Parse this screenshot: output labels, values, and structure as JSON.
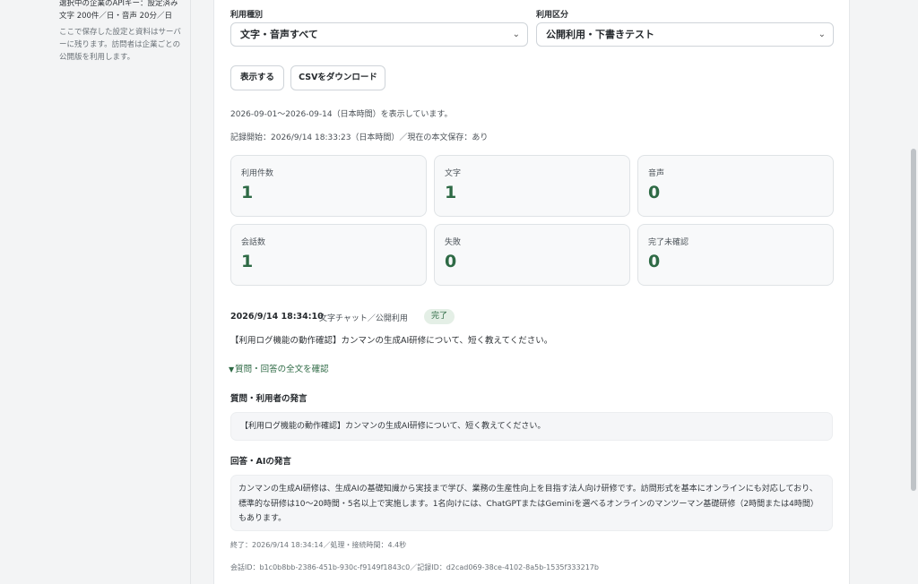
{
  "sidebar": {
    "api_key_status": "選択中の企業のAPIキー：設定済み",
    "limits": "文字 200件／日・音声 20分／日",
    "note": "ここで保存した設定と資料はサーバーに残ります。訪問者は企業ごとの公開版を利用します。"
  },
  "filters": {
    "usage_type_label": "利用種別",
    "usage_type_value": "文字・音声すべて",
    "usage_scope_label": "利用区分",
    "usage_scope_value": "公開利用・下書きテスト"
  },
  "actions": {
    "show_label": "表示する",
    "csv_label": "CSVをダウンロード"
  },
  "summary": {
    "range_text": "2026-09-01〜2026-09-14（日本時間）を表示しています。",
    "record_text": "記録開始：2026/9/14 18:33:23（日本時間）／現在の本文保存：あり"
  },
  "stats": [
    {
      "label": "利用件数",
      "value": "1"
    },
    {
      "label": "文字",
      "value": "1"
    },
    {
      "label": "音声",
      "value": "0"
    },
    {
      "label": "会話数",
      "value": "1"
    },
    {
      "label": "失敗",
      "value": "0"
    },
    {
      "label": "完了未確認",
      "value": "0"
    }
  ],
  "log": {
    "time": "2026/9/14 18:34:10",
    "meta": "文字チャット／公開利用",
    "status": "完了",
    "question_preview": "【利用ログ機能の動作確認】カンマンの生成AI研修について、短く教えてください。",
    "toggle_label": "質問・回答の全文を確認",
    "question_heading": "質問・利用者の発言",
    "question_full": "【利用ログ機能の動作確認】カンマンの生成AI研修について、短く教えてください。",
    "answer_heading": "回答・AIの発言",
    "answer_full": "カンマンの生成AI研修は、生成AIの基礎知識から実技まで学び、業務の生産性向上を目指す法人向け研修です。訪問形式を基本にオンラインにも対応しており、標準的な研修は10〜20時間・5名以上で実施します。1名向けには、ChatGPTまたはGeminiを選べるオンラインのマンツーマン基礎研修（2時間または4時間）もあります。",
    "end_info": "終了：2026/9/14 18:34:14／処理・接続時間：4.4秒",
    "ids": "会話ID：b1c0b8bb-2386-451b-930c-f9149f1843c0／記録ID：d2cad069-38ce-4102-8a5b-1535f333217b"
  },
  "colors": {
    "accent": "#2e6a45",
    "badge_bg": "#e4efe6"
  }
}
